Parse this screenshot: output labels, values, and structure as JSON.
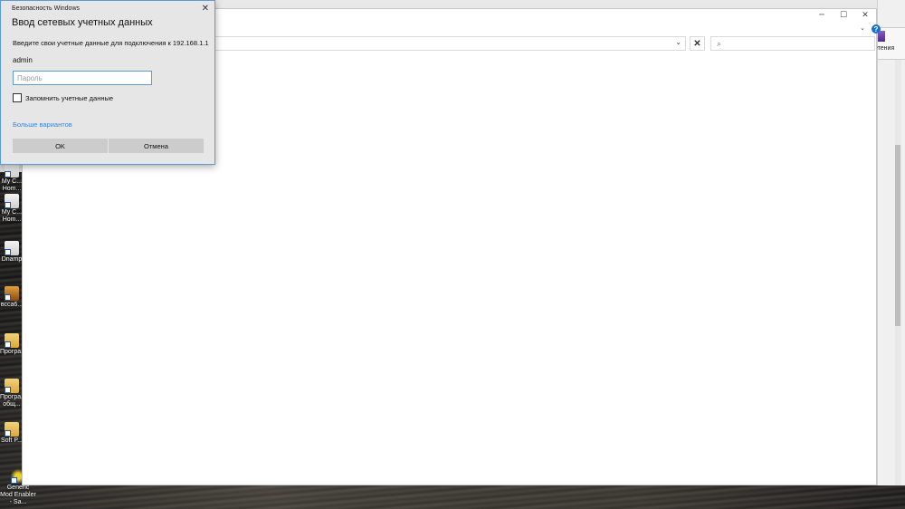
{
  "desktop": {
    "icons": [
      {
        "label": "My C... Hom...",
        "kind": "doc"
      },
      {
        "label": "My C... Hom...",
        "kind": "doc"
      },
      {
        "label": "Dnamp",
        "kind": "doc"
      },
      {
        "label": "всса6...",
        "kind": "orange"
      },
      {
        "label": "Програ...",
        "kind": "folder"
      },
      {
        "label": "Програ... общ...",
        "kind": "folder"
      },
      {
        "label": "Soft P...",
        "kind": "folder"
      },
      {
        "label": "Generic Mod Enabler - Sa...",
        "kind": "app"
      }
    ]
  },
  "explorer": {
    "minimize_icon": "minimize-icon",
    "maximize_icon": "maximize-icon",
    "close_icon": "close-icon",
    "address_value": "",
    "dropdown_glyph": "⌄",
    "clear_glyph": "✕",
    "search_placeholder": "",
    "search_glyph": "⌕",
    "collapse_glyph": "⌄",
    "help_glyph": "?"
  },
  "right_window": {
    "ribbon_label": "етения"
  },
  "dialog": {
    "caption": "Безопасность Windows",
    "close_glyph": "✕",
    "title": "Ввод сетевых учетных данных",
    "description": "Введите свои учетные данные для подключения к 192.168.1.1",
    "username": "admin",
    "password_placeholder": "Пароль",
    "remember_label": "Запомнить учетные данные",
    "remember_checked": false,
    "more_options": "Больше вариантов",
    "ok_label": "OK",
    "cancel_label": "Отмена",
    "accent_color": "#5b9bd5",
    "link_color": "#3c84d6"
  }
}
